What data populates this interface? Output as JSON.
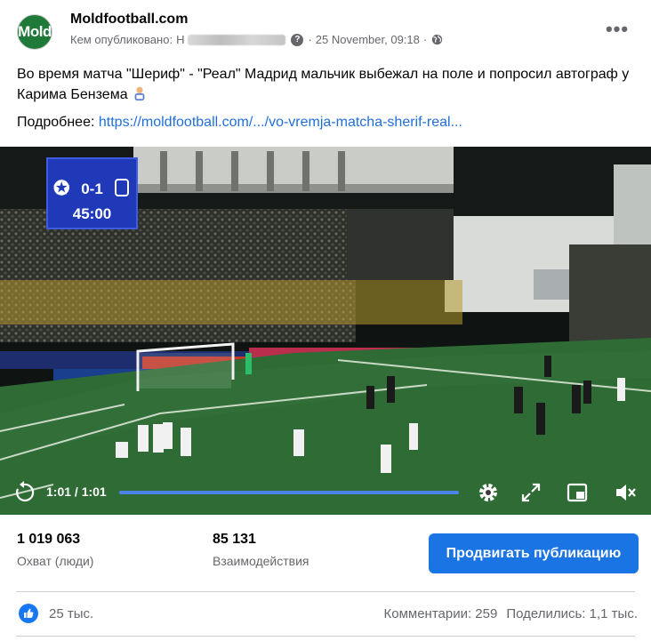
{
  "post": {
    "page_name": "Moldfootball.com",
    "avatar_text": "Mold",
    "published_by_label": "Кем опубликовано:",
    "published_by_initial": "Н",
    "date": "25 November, 09:18",
    "separator": "·",
    "more_icon": "more-dots-icon",
    "text": "Во время матча \"Шериф\" - \"Реал\" Мадрид мальчик выбежал на поле и попросил автограф у Карима Бензема",
    "more_prefix": "Подробнее:",
    "link_text": "https://moldfootball.com/.../vo-vremja-matcha-sherif-real..."
  },
  "video": {
    "scoreboard": {
      "home": "✪",
      "score": "0-1",
      "time": "45:00"
    },
    "time_label": "1:01 / 1:01",
    "progress": 1.0,
    "icons": [
      "replay-icon",
      "gear-icon",
      "fullscreen-icon",
      "pip-icon",
      "mute-icon"
    ]
  },
  "stats": {
    "reach_value": "1 019 063",
    "reach_label": "Охват (люди)",
    "engagement_value": "85 131",
    "engagement_label": "Взаимодействия",
    "boost_label": "Продвигать публикацию"
  },
  "reactions": {
    "likes": "25 тыс.",
    "comments": "Комментарии: 259",
    "shares": "Поделились: 1,1 тыс."
  },
  "colors": {
    "accent": "#1b74e4",
    "link": "#216fdb",
    "secondary_text": "#65676b"
  }
}
